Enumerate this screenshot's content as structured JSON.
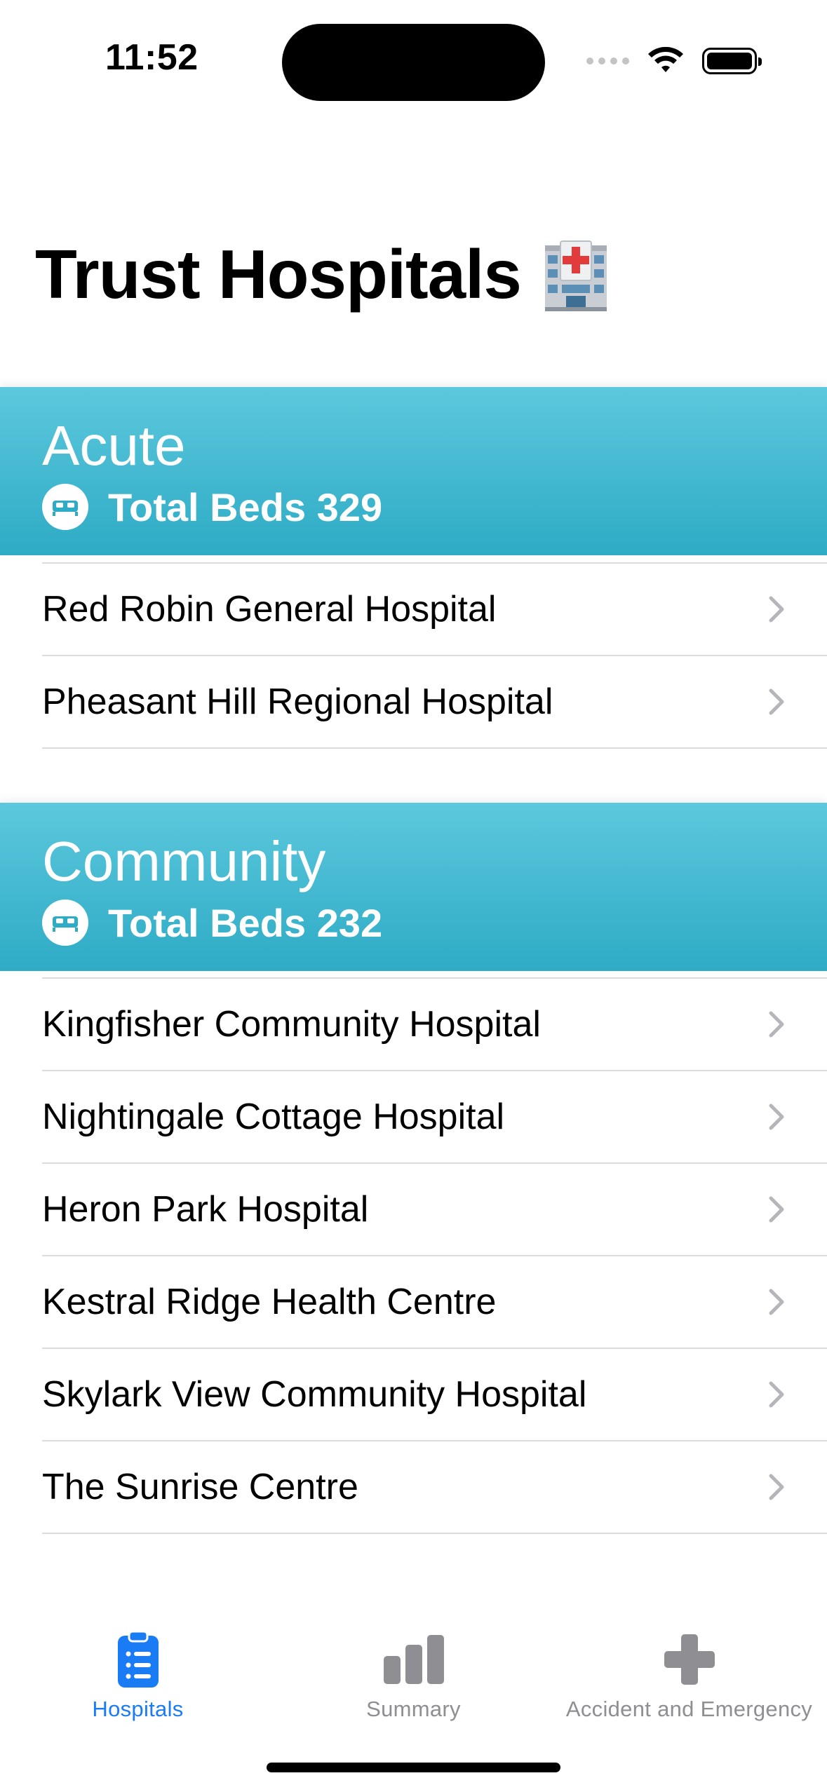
{
  "status_bar": {
    "time": "11:52"
  },
  "page": {
    "title": "Trust Hospitals"
  },
  "sections": [
    {
      "title": "Acute",
      "beds_label": "Total Beds 329",
      "hospitals": [
        "Red Robin General Hospital",
        "Pheasant Hill Regional Hospital"
      ]
    },
    {
      "title": "Community",
      "beds_label": "Total Beds 232",
      "hospitals": [
        "Kingfisher Community Hospital",
        "Nightingale Cottage Hospital",
        "Heron Park Hospital",
        "Kestral Ridge Health Centre",
        "Skylark View Community Hospital",
        "The Sunrise Centre"
      ]
    }
  ],
  "tabs": [
    {
      "label": "Hospitals",
      "icon": "clipboard-list-icon",
      "active": true
    },
    {
      "label": "Summary",
      "icon": "bar-chart-icon",
      "active": false
    },
    {
      "label": "Accident and Emergency",
      "icon": "cross-icon",
      "active": false
    }
  ],
  "colors": {
    "section_header_top": "#5cc8dd",
    "section_header_bottom": "#2eabc5",
    "accent": "#1a7cf5",
    "tab_inactive": "#8e8e93"
  }
}
